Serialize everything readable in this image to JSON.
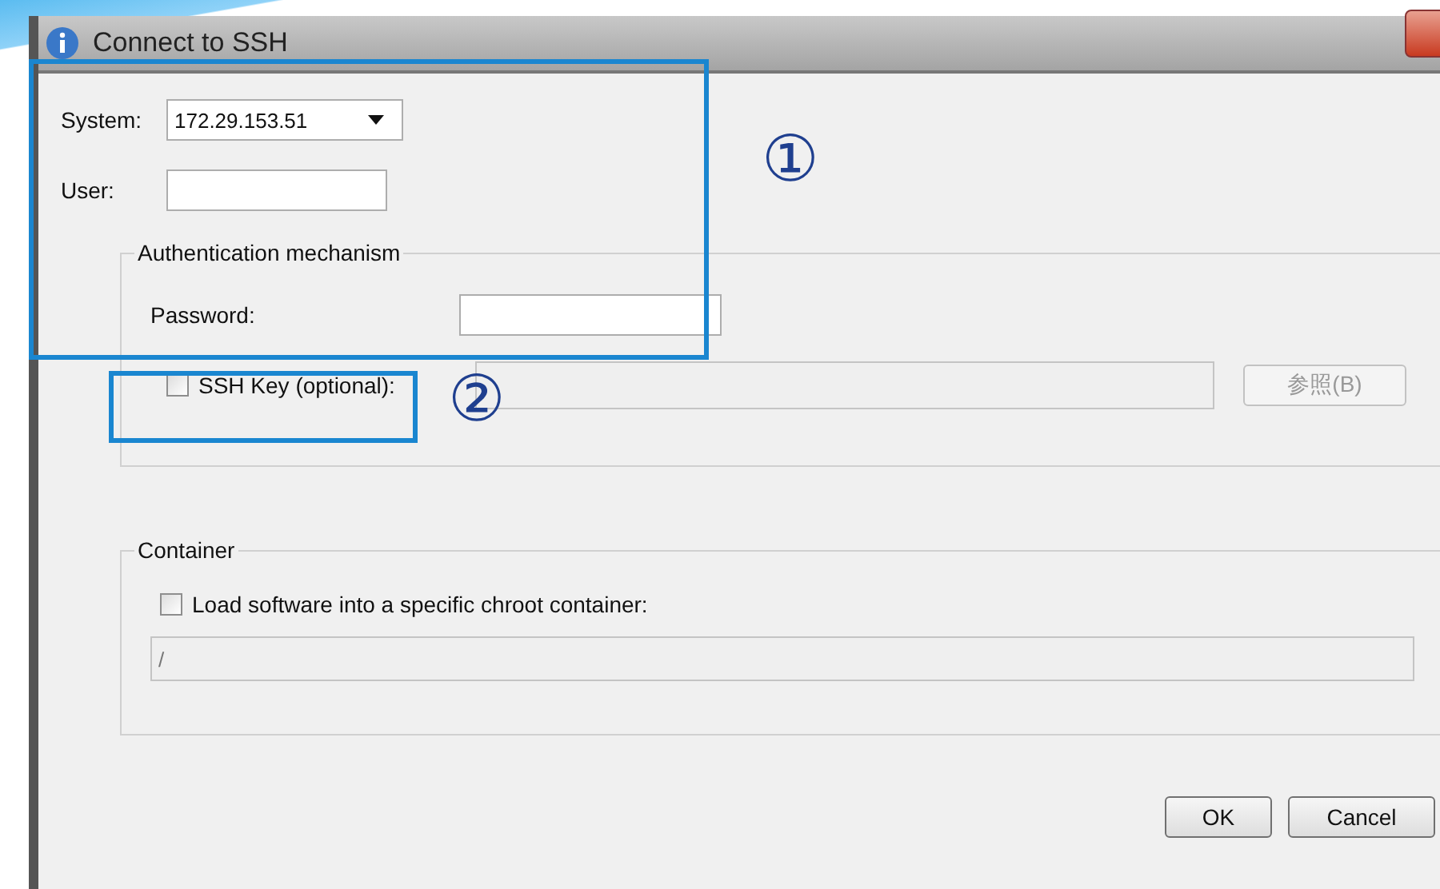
{
  "window": {
    "title": "Connect to SSH"
  },
  "system": {
    "label": "System:",
    "value": "172.29.153.51"
  },
  "user": {
    "label": "User:"
  },
  "authentication": {
    "legend": "Authentication mechanism",
    "password": {
      "label": "Password:"
    },
    "ssh_key": {
      "label": "SSH Key (optional):",
      "checked": false
    },
    "browse_button": {
      "label": "参照(B)",
      "disabled": true
    }
  },
  "container": {
    "legend": "Container",
    "checkbox": {
      "label": "Load software into a specific chroot container:",
      "checked": false
    },
    "path": {
      "value": "/"
    }
  },
  "buttons": [
    {
      "label": "OK"
    },
    {
      "label": "Cancel"
    }
  ],
  "annotations": [
    {
      "label": "①"
    },
    {
      "label": "②"
    }
  ]
}
